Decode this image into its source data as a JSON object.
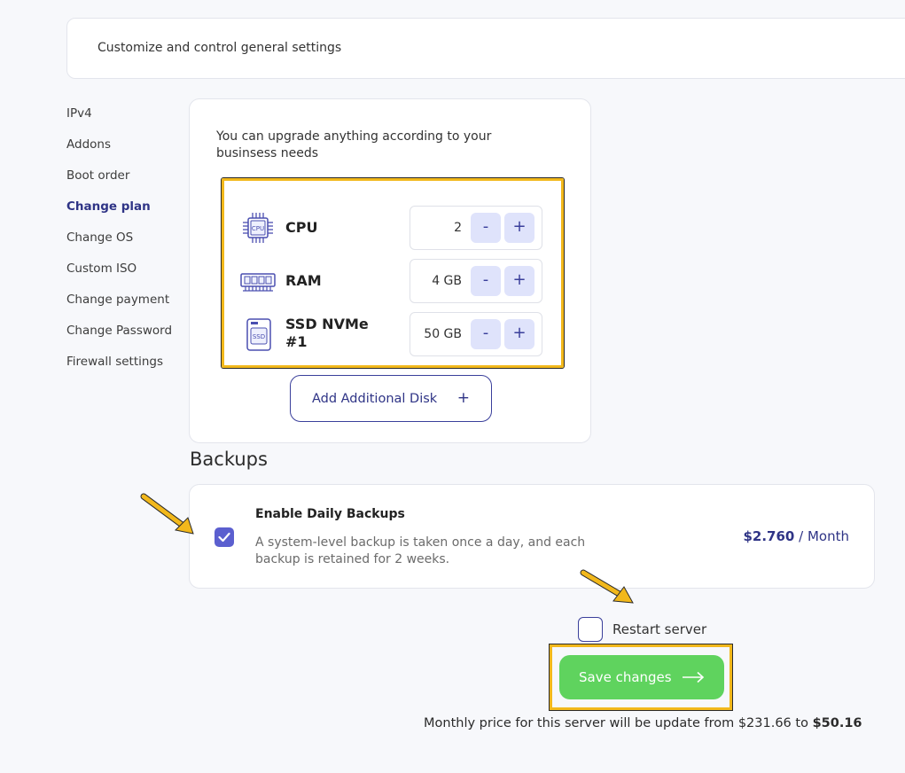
{
  "header": {
    "subtitle": "Customize and control general settings"
  },
  "sidebar": {
    "items": [
      {
        "label": "IPv4"
      },
      {
        "label": "Addons"
      },
      {
        "label": "Boot order"
      },
      {
        "label": "Change plan",
        "active": true
      },
      {
        "label": "Change OS"
      },
      {
        "label": "Custom ISO"
      },
      {
        "label": "Change payment"
      },
      {
        "label": "Change Password"
      },
      {
        "label": "Firewall settings"
      }
    ]
  },
  "plan": {
    "intro": "You can upgrade anything according to your businsess needs",
    "resources": [
      {
        "name": "CPU",
        "value": "2",
        "icon": "cpu-icon",
        "icon_text": "CPU"
      },
      {
        "name": "RAM",
        "value": "4 GB",
        "icon": "ram-icon"
      },
      {
        "name": "SSD NVMe #1",
        "value": "50 GB",
        "icon": "ssd-icon",
        "icon_text": "SSD"
      }
    ],
    "minus_label": "-",
    "plus_label": "+",
    "add_disk_label": "Add Additional Disk",
    "add_disk_icon": "+"
  },
  "backups": {
    "title": "Backups",
    "option_title": "Enable Daily Backups",
    "option_desc": "A system-level backup is taken once a day, and each backup is retained for 2 weeks.",
    "price": "$2.760",
    "period": "/ Month",
    "checked": true
  },
  "restart": {
    "label": "Restart server",
    "checked": false
  },
  "save": {
    "label": "Save changes"
  },
  "price_note": {
    "text": "Monthly price for this server will be update from $231.66 to",
    "new_price": "$50.16"
  },
  "colors": {
    "accent": "#2f3486",
    "save": "#5fd35e",
    "highlight": "#f2b81b",
    "stepper_bg": "#dfe3fb"
  }
}
